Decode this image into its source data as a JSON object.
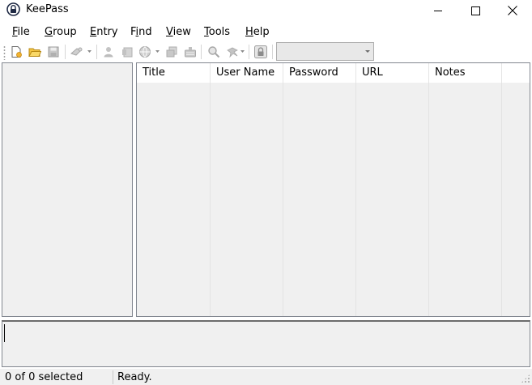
{
  "window": {
    "title": "KeePass",
    "icon": "keepass-lock-icon"
  },
  "menu": [
    {
      "label_acc": "F",
      "label_rest": "ile"
    },
    {
      "label_acc": "G",
      "label_rest": "roup"
    },
    {
      "label_acc": "E",
      "label_rest": "ntry"
    },
    {
      "label_pre": "F",
      "label_acc": "i",
      "label_rest": "nd"
    },
    {
      "label_acc": "V",
      "label_rest": "iew"
    },
    {
      "label_acc": "T",
      "label_rest": "ools"
    },
    {
      "label_acc": "H",
      "label_rest": "elp"
    }
  ],
  "toolbar": {
    "icons": [
      "new-database-icon",
      "open-database-icon",
      "save-icon",
      "add-entry-icon",
      "copy-username-icon",
      "copy-password-icon",
      "open-url-icon",
      "copy-entry-icon",
      "autotype-icon",
      "find-icon",
      "entries-icon",
      "lock-icon"
    ],
    "quick_find_value": ""
  },
  "entry_list": {
    "columns": [
      "Title",
      "User Name",
      "Password",
      "URL",
      "Notes"
    ]
  },
  "status": {
    "selection": "0 of 0 selected",
    "message": "Ready."
  }
}
